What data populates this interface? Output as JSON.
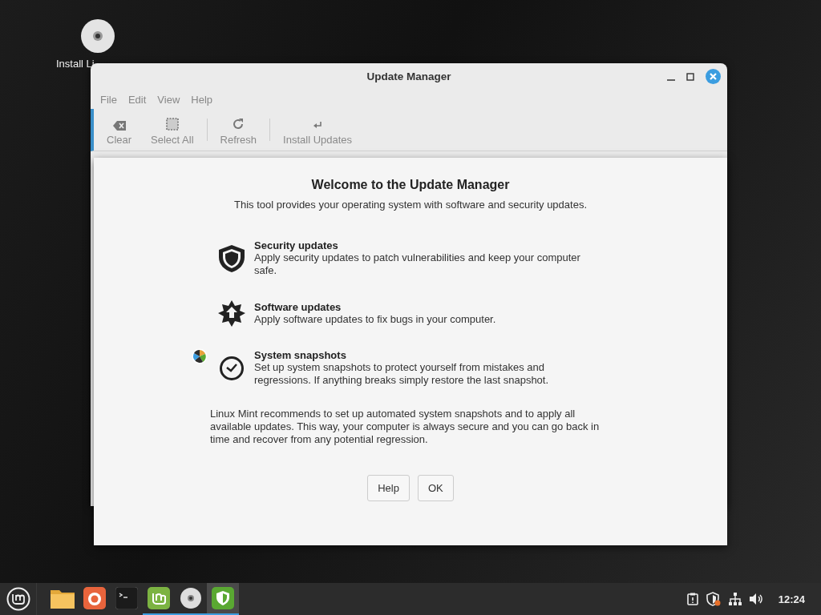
{
  "desktop_icons": [
    {
      "label": "Install Li"
    }
  ],
  "window": {
    "title": "Update Manager",
    "menu": [
      "File",
      "Edit",
      "View",
      "Help"
    ],
    "toolbar": [
      {
        "kind": "clear",
        "label": "Clear"
      },
      {
        "kind": "select",
        "label": "Select All"
      },
      {
        "kind": "refresh",
        "label": "Refresh"
      },
      {
        "kind": "install",
        "label": "Install Updates"
      }
    ]
  },
  "welcome": {
    "title": "Welcome to the Update Manager",
    "subtitle": "This tool provides your operating system with software and security updates.",
    "features": [
      {
        "kind": "shield",
        "title": "Security updates",
        "text": "Apply security updates to patch vulnerabilities and keep your computer safe."
      },
      {
        "kind": "star",
        "title": "Software updates",
        "text": "Apply software updates to fix bugs in your computer."
      },
      {
        "kind": "clock",
        "title": "System snapshots",
        "text": "Set up system snapshots to protect yourself from mistakes and regressions. If anything breaks simply restore the last snapshot."
      }
    ],
    "note": "Linux Mint recommends to set up automated system snapshots and to apply all available updates. This way, your computer is always secure and you can go back in time and recover from any potential regression.",
    "buttons": [
      "Help",
      "OK"
    ]
  },
  "taskbar": {
    "apps": [
      {
        "kind": "folder",
        "running": false,
        "selected": false
      },
      {
        "kind": "browser",
        "running": false,
        "selected": false
      },
      {
        "kind": "terminal",
        "running": false,
        "selected": false
      },
      {
        "kind": "mint",
        "running": true,
        "selected": false
      },
      {
        "kind": "disc",
        "running": true,
        "selected": false
      },
      {
        "kind": "shield",
        "running": true,
        "selected": true
      }
    ],
    "tray": [
      {
        "kind": "notes"
      },
      {
        "kind": "shield"
      },
      {
        "kind": "network"
      },
      {
        "kind": "volume"
      }
    ],
    "clock": "12:24"
  }
}
